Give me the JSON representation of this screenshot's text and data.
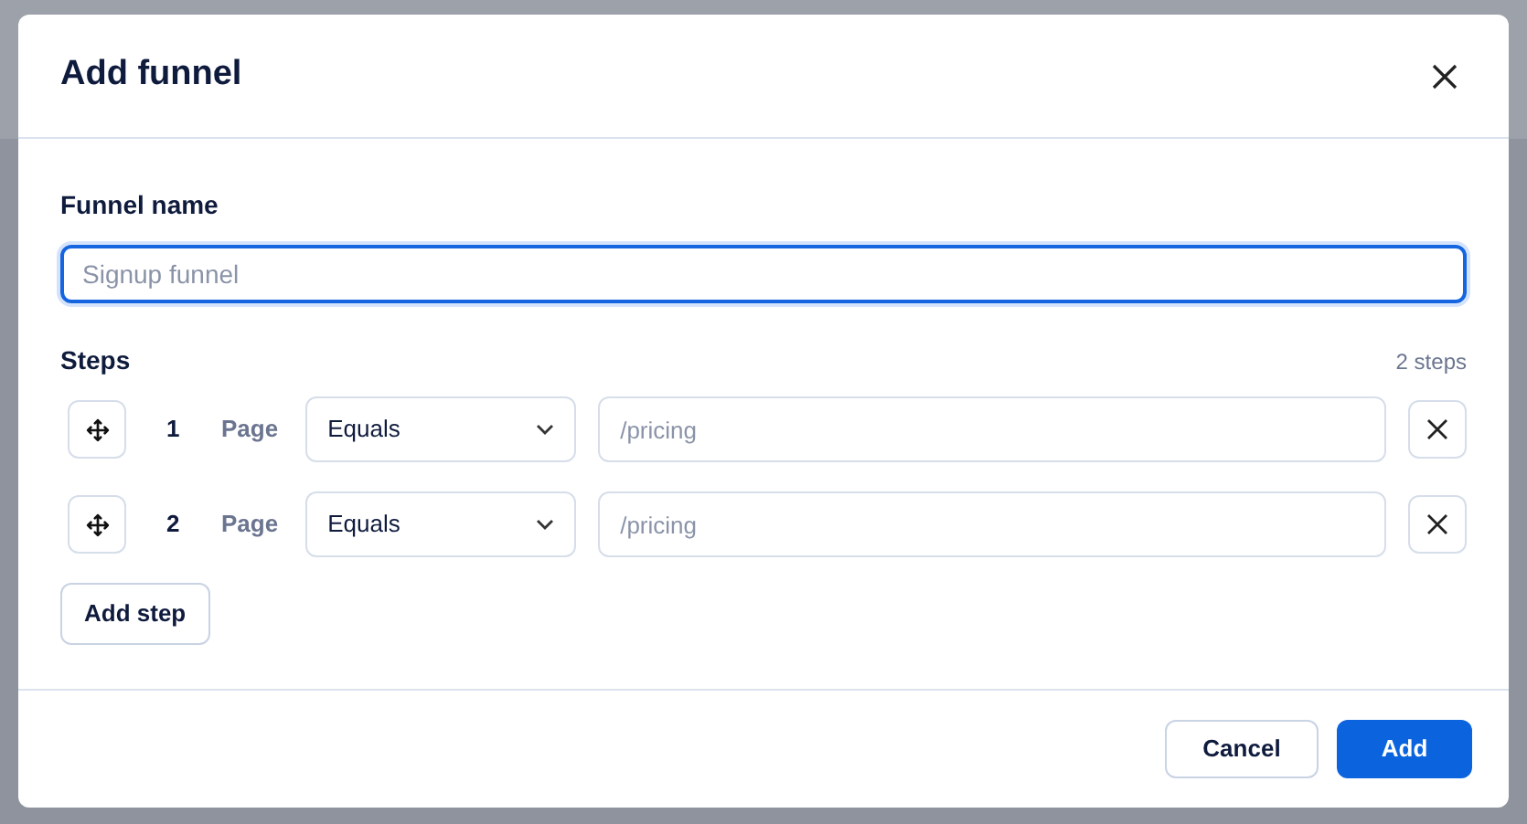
{
  "dialog": {
    "title": "Add funnel"
  },
  "funnel_name": {
    "label": "Funnel name",
    "placeholder": "Signup funnel",
    "focused": true
  },
  "steps": {
    "label": "Steps",
    "count": "2 steps",
    "items": [
      {
        "number": "1",
        "type": "Page",
        "operator": "Equals",
        "placeholder": "/pricing"
      },
      {
        "number": "2",
        "type": "Page",
        "operator": "Equals",
        "placeholder": "/pricing"
      }
    ],
    "add_button": "Add step"
  },
  "buttons": [
    {
      "label": "Cancel",
      "kind": "secondary"
    },
    {
      "label": "Add",
      "kind": "primary"
    }
  ]
}
